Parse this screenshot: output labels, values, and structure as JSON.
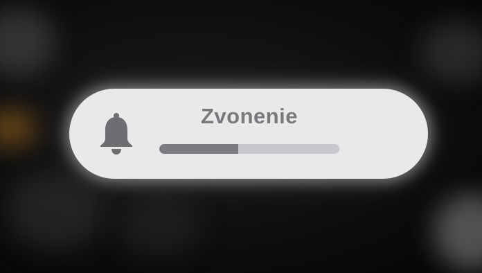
{
  "volume_hud": {
    "title": "Zvonenie",
    "icon": "bell-icon",
    "level": 0.44
  },
  "colors": {
    "hud_background": "#e9e9ea",
    "text": "#7a7a7e",
    "fill": "#7b7c80",
    "track": "#c7c8cb"
  }
}
